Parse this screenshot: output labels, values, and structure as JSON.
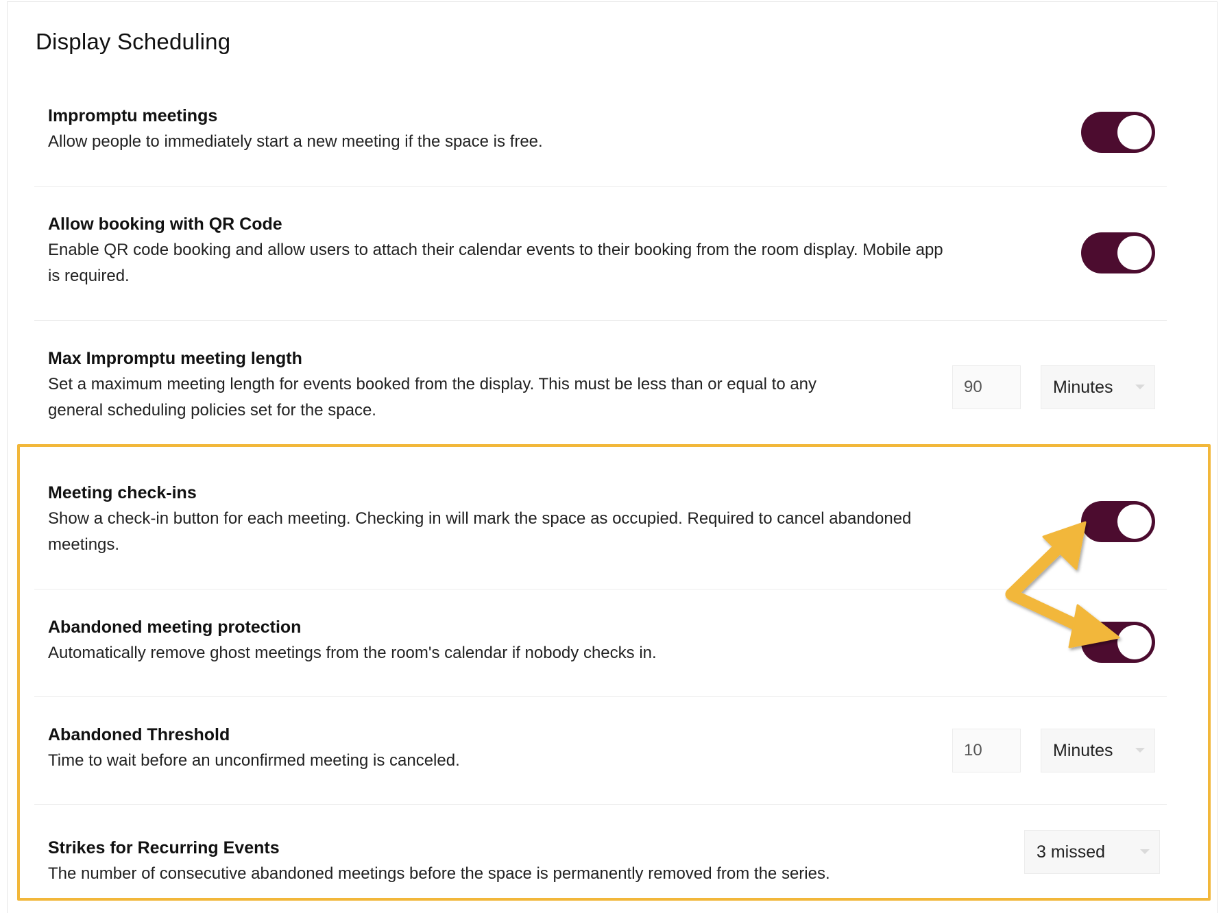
{
  "page": {
    "title": "Display Scheduling"
  },
  "settings": {
    "impromptu": {
      "label": "Impromptu meetings",
      "description": "Allow people to immediately start a new meeting if the space is free.",
      "enabled": true
    },
    "qr_booking": {
      "label": "Allow booking with QR Code",
      "description_line1": "Enable QR code booking and allow users to attach their calendar events to their booking from the room display. Mobile app",
      "description_line2": "is required.",
      "enabled": true
    },
    "max_length": {
      "label": "Max Impromptu meeting length",
      "description_line1": "Set a maximum meeting length for events booked from the display. This must be less than or equal to any",
      "description_line2": "general scheduling policies set for the space.",
      "value": "90",
      "unit": "Minutes"
    },
    "check_ins": {
      "label": "Meeting check-ins",
      "description_line1": "Show a check-in button for each meeting. Checking in will mark the space as occupied. Required to cancel abandoned",
      "description_line2": "meetings.",
      "enabled": true
    },
    "abandoned_protection": {
      "label": "Abandoned meeting protection",
      "description": "Automatically remove ghost meetings from the room's calendar if nobody checks in.",
      "enabled": true
    },
    "abandoned_threshold": {
      "label": "Abandoned Threshold",
      "description": "Time to wait before an unconfirmed meeting is canceled.",
      "value": "10",
      "unit": "Minutes"
    },
    "strikes": {
      "label": "Strikes for Recurring Events",
      "description": "The number of consecutive abandoned meetings before the space is permanently removed from the series.",
      "value": "3 missed"
    }
  },
  "colors": {
    "toggle_on": "#4c0c2f",
    "highlight": "#f2b73a"
  },
  "annotations": {
    "icons": [
      "arrow-annotation-icon",
      "chevron-down-icon"
    ]
  }
}
